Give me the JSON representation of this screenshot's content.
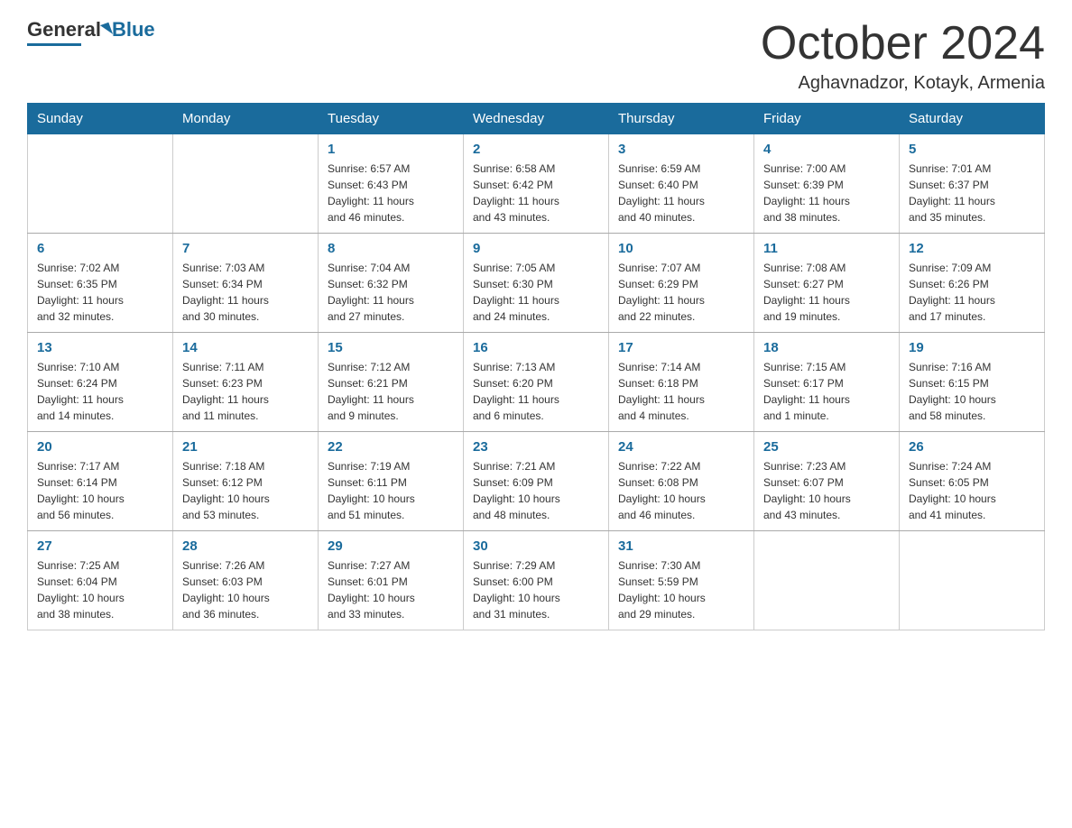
{
  "logo": {
    "general": "General",
    "blue": "Blue"
  },
  "title": "October 2024",
  "subtitle": "Aghavnadzor, Kotayk, Armenia",
  "days_of_week": [
    "Sunday",
    "Monday",
    "Tuesday",
    "Wednesday",
    "Thursday",
    "Friday",
    "Saturday"
  ],
  "weeks": [
    [
      {
        "day": "",
        "info": ""
      },
      {
        "day": "",
        "info": ""
      },
      {
        "day": "1",
        "info": "Sunrise: 6:57 AM\nSunset: 6:43 PM\nDaylight: 11 hours\nand 46 minutes."
      },
      {
        "day": "2",
        "info": "Sunrise: 6:58 AM\nSunset: 6:42 PM\nDaylight: 11 hours\nand 43 minutes."
      },
      {
        "day": "3",
        "info": "Sunrise: 6:59 AM\nSunset: 6:40 PM\nDaylight: 11 hours\nand 40 minutes."
      },
      {
        "day": "4",
        "info": "Sunrise: 7:00 AM\nSunset: 6:39 PM\nDaylight: 11 hours\nand 38 minutes."
      },
      {
        "day": "5",
        "info": "Sunrise: 7:01 AM\nSunset: 6:37 PM\nDaylight: 11 hours\nand 35 minutes."
      }
    ],
    [
      {
        "day": "6",
        "info": "Sunrise: 7:02 AM\nSunset: 6:35 PM\nDaylight: 11 hours\nand 32 minutes."
      },
      {
        "day": "7",
        "info": "Sunrise: 7:03 AM\nSunset: 6:34 PM\nDaylight: 11 hours\nand 30 minutes."
      },
      {
        "day": "8",
        "info": "Sunrise: 7:04 AM\nSunset: 6:32 PM\nDaylight: 11 hours\nand 27 minutes."
      },
      {
        "day": "9",
        "info": "Sunrise: 7:05 AM\nSunset: 6:30 PM\nDaylight: 11 hours\nand 24 minutes."
      },
      {
        "day": "10",
        "info": "Sunrise: 7:07 AM\nSunset: 6:29 PM\nDaylight: 11 hours\nand 22 minutes."
      },
      {
        "day": "11",
        "info": "Sunrise: 7:08 AM\nSunset: 6:27 PM\nDaylight: 11 hours\nand 19 minutes."
      },
      {
        "day": "12",
        "info": "Sunrise: 7:09 AM\nSunset: 6:26 PM\nDaylight: 11 hours\nand 17 minutes."
      }
    ],
    [
      {
        "day": "13",
        "info": "Sunrise: 7:10 AM\nSunset: 6:24 PM\nDaylight: 11 hours\nand 14 minutes."
      },
      {
        "day": "14",
        "info": "Sunrise: 7:11 AM\nSunset: 6:23 PM\nDaylight: 11 hours\nand 11 minutes."
      },
      {
        "day": "15",
        "info": "Sunrise: 7:12 AM\nSunset: 6:21 PM\nDaylight: 11 hours\nand 9 minutes."
      },
      {
        "day": "16",
        "info": "Sunrise: 7:13 AM\nSunset: 6:20 PM\nDaylight: 11 hours\nand 6 minutes."
      },
      {
        "day": "17",
        "info": "Sunrise: 7:14 AM\nSunset: 6:18 PM\nDaylight: 11 hours\nand 4 minutes."
      },
      {
        "day": "18",
        "info": "Sunrise: 7:15 AM\nSunset: 6:17 PM\nDaylight: 11 hours\nand 1 minute."
      },
      {
        "day": "19",
        "info": "Sunrise: 7:16 AM\nSunset: 6:15 PM\nDaylight: 10 hours\nand 58 minutes."
      }
    ],
    [
      {
        "day": "20",
        "info": "Sunrise: 7:17 AM\nSunset: 6:14 PM\nDaylight: 10 hours\nand 56 minutes."
      },
      {
        "day": "21",
        "info": "Sunrise: 7:18 AM\nSunset: 6:12 PM\nDaylight: 10 hours\nand 53 minutes."
      },
      {
        "day": "22",
        "info": "Sunrise: 7:19 AM\nSunset: 6:11 PM\nDaylight: 10 hours\nand 51 minutes."
      },
      {
        "day": "23",
        "info": "Sunrise: 7:21 AM\nSunset: 6:09 PM\nDaylight: 10 hours\nand 48 minutes."
      },
      {
        "day": "24",
        "info": "Sunrise: 7:22 AM\nSunset: 6:08 PM\nDaylight: 10 hours\nand 46 minutes."
      },
      {
        "day": "25",
        "info": "Sunrise: 7:23 AM\nSunset: 6:07 PM\nDaylight: 10 hours\nand 43 minutes."
      },
      {
        "day": "26",
        "info": "Sunrise: 7:24 AM\nSunset: 6:05 PM\nDaylight: 10 hours\nand 41 minutes."
      }
    ],
    [
      {
        "day": "27",
        "info": "Sunrise: 7:25 AM\nSunset: 6:04 PM\nDaylight: 10 hours\nand 38 minutes."
      },
      {
        "day": "28",
        "info": "Sunrise: 7:26 AM\nSunset: 6:03 PM\nDaylight: 10 hours\nand 36 minutes."
      },
      {
        "day": "29",
        "info": "Sunrise: 7:27 AM\nSunset: 6:01 PM\nDaylight: 10 hours\nand 33 minutes."
      },
      {
        "day": "30",
        "info": "Sunrise: 7:29 AM\nSunset: 6:00 PM\nDaylight: 10 hours\nand 31 minutes."
      },
      {
        "day": "31",
        "info": "Sunrise: 7:30 AM\nSunset: 5:59 PM\nDaylight: 10 hours\nand 29 minutes."
      },
      {
        "day": "",
        "info": ""
      },
      {
        "day": "",
        "info": ""
      }
    ]
  ]
}
